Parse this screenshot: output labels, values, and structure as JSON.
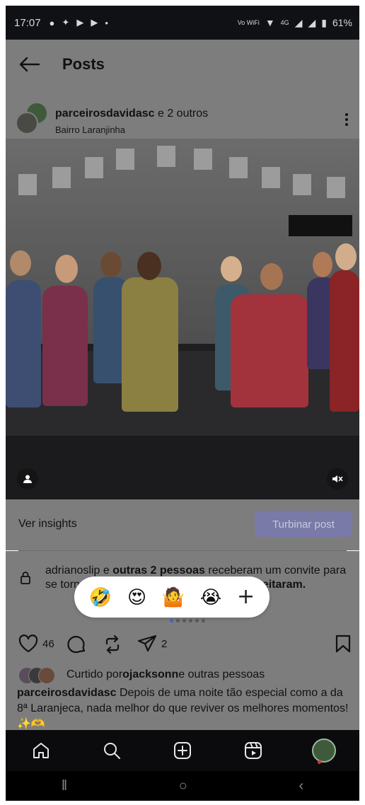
{
  "status_bar": {
    "time": "17:07",
    "network": "4G",
    "wifi_label": "Vo WiFi",
    "battery": "61%"
  },
  "header": {
    "title": "Posts"
  },
  "post": {
    "author": "parceirosdavidasc",
    "coauthors_suffix": "e 2 outros",
    "location": "Bairro Laranjinha"
  },
  "insights": {
    "view_label": "Ver insights",
    "boost_label": "Turbinar post"
  },
  "invite": {
    "user": "adrianoslip",
    "middle": " e ",
    "others": "outras 2 pessoas",
    "received": " receberam um convite para se tornar colaboradores, mas ainda ",
    "not_accepted": "não aceitaram."
  },
  "reactions": [
    "🤣",
    "😍",
    "🤷",
    "😭",
    "+"
  ],
  "actions": {
    "likes": "46",
    "shares": "2"
  },
  "liked_by": {
    "prefix": "Curtido por ",
    "user": "ojacksonn",
    "suffix": " e outras pessoas"
  },
  "caption": {
    "user": "parceirosdavidasc",
    "text": " Depois de uma noite tão especial como a da 8ª Laranjeca, nada melhor do que reviver os melhores momentos! ✨🫶"
  },
  "colors": {
    "accent": "#4763c7",
    "boost_button": "#7a7aa8",
    "notification_dot": "#e0352b"
  }
}
